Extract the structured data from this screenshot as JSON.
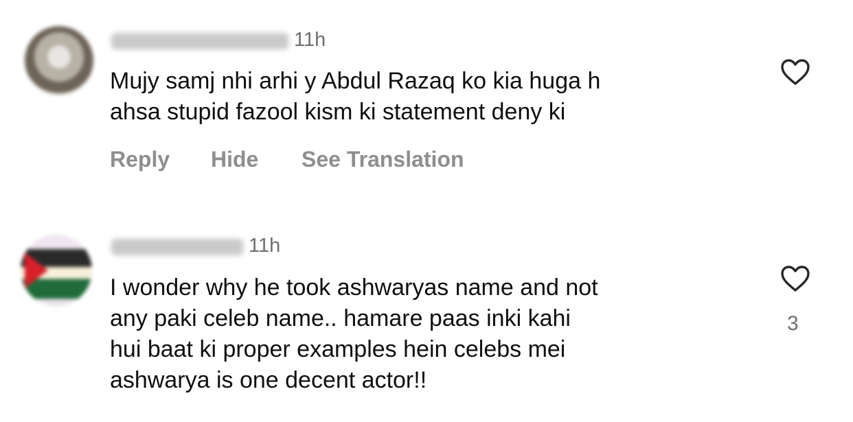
{
  "comments": [
    {
      "time": "11h",
      "lines": [
        "Mujy samj nhi arhi y Abdul Razaq ko kia huga h",
        "ahsa stupid fazool kism ki statement deny ki"
      ],
      "actions": {
        "reply": "Reply",
        "hide": "Hide",
        "translate": "See Translation"
      },
      "like_icon": "heart-outline-icon"
    },
    {
      "time": "11h",
      "lines": [
        "I wonder why he took ashwaryas name and not",
        "any paki celeb name.. hamare paas inki kahi",
        "hui baat ki proper examples hein celebs mei",
        "ashwarya is one decent actor!!"
      ],
      "like_icon": "heart-outline-icon",
      "like_count": "3"
    }
  ]
}
